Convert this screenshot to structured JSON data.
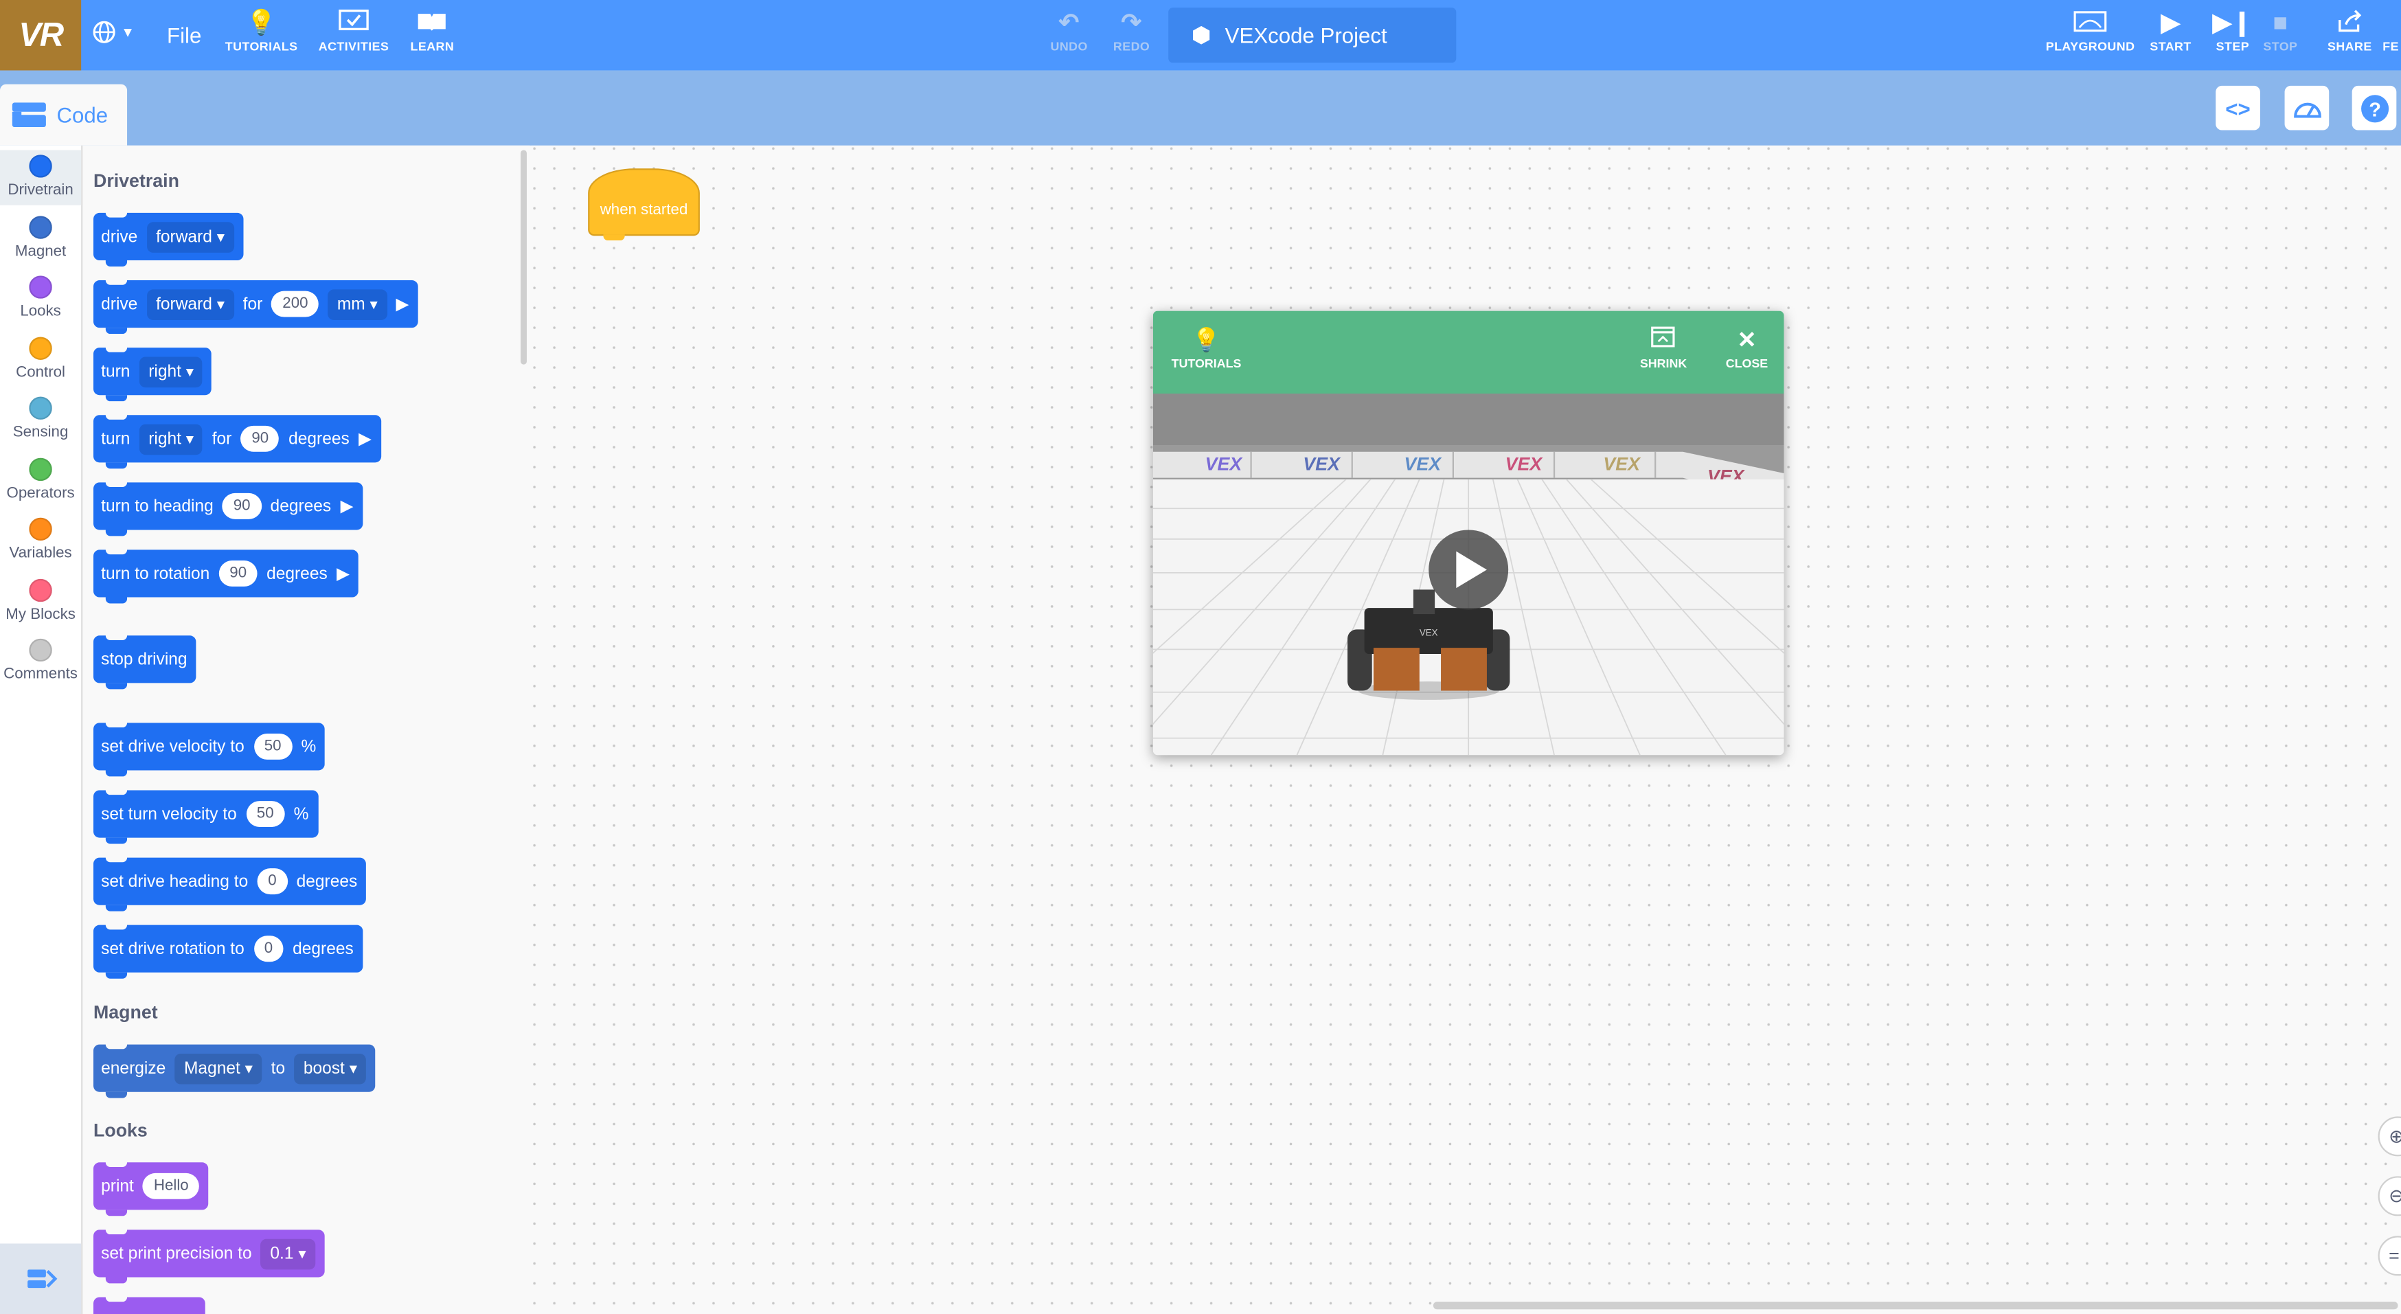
{
  "app": {
    "logo": "VR",
    "file_menu": "File",
    "project_name": "VEXcode Project"
  },
  "toolbar_left": [
    {
      "label": "TUTORIALS",
      "icon": "lightbulb-icon"
    },
    {
      "label": "ACTIVITIES",
      "icon": "check-screen-icon"
    },
    {
      "label": "LEARN",
      "icon": "book-icon"
    }
  ],
  "toolbar_center": [
    {
      "label": "UNDO",
      "icon": "undo-icon",
      "enabled": false
    },
    {
      "label": "REDO",
      "icon": "redo-icon",
      "enabled": false
    }
  ],
  "toolbar_right": [
    {
      "label": "PLAYGROUND",
      "icon": "playground-icon"
    },
    {
      "label": "START",
      "icon": "play-icon"
    },
    {
      "label": "STEP",
      "icon": "step-icon"
    },
    {
      "label": "STOP",
      "icon": "stop-icon",
      "enabled": false
    },
    {
      "label": "SHARE",
      "icon": "share-icon"
    },
    {
      "label": "FE",
      "icon": "feedback-icon"
    }
  ],
  "code_tab": "Code",
  "categories": [
    {
      "label": "Drivetrain",
      "color": "#1f6ff2",
      "selected": true
    },
    {
      "label": "Magnet",
      "color": "#3b72cf"
    },
    {
      "label": "Looks",
      "color": "#9b5cf0"
    },
    {
      "label": "Control",
      "color": "#ffab19"
    },
    {
      "label": "Sensing",
      "color": "#5cb1d6"
    },
    {
      "label": "Operators",
      "color": "#59c059"
    },
    {
      "label": "Variables",
      "color": "#ff8c1a"
    },
    {
      "label": "My Blocks",
      "color": "#ff6680"
    },
    {
      "label": "Comments",
      "color": "#c8c8c8"
    }
  ],
  "palette": {
    "drivetrain_title": "Drivetrain",
    "magnet_title": "Magnet",
    "looks_title": "Looks",
    "blocks": {
      "drive_label": "drive",
      "forward": "forward",
      "for_label": "for",
      "distance_value": "200",
      "mm": "mm",
      "turn_label": "turn",
      "right": "right",
      "turn_value": "90",
      "degrees": "degrees",
      "turn_to_heading": "turn to heading",
      "heading_value": "90",
      "turn_to_rotation": "turn to rotation",
      "rotation_value": "90",
      "stop_driving": "stop driving",
      "set_drive_velocity": "set drive velocity to",
      "drive_velocity_value": "50",
      "percent": "%",
      "set_turn_velocity": "set turn velocity to",
      "turn_velocity_value": "50",
      "set_drive_heading": "set drive heading to",
      "drive_heading_value": "0",
      "set_drive_rotation": "set drive rotation to",
      "drive_rotation_value": "0",
      "energize": "energize",
      "magnet": "Magnet",
      "to_label": "to",
      "boost": "boost",
      "print": "print",
      "print_value": "Hello",
      "set_print_precision": "set print precision to",
      "precision_value": "0.1"
    }
  },
  "workspace": {
    "hat_block": "when started"
  },
  "playground": {
    "tutorials": "TUTORIALS",
    "shrink": "SHRINK",
    "close": "CLOSE",
    "wall_brand": "VEX",
    "robot_brand": "VEX"
  }
}
